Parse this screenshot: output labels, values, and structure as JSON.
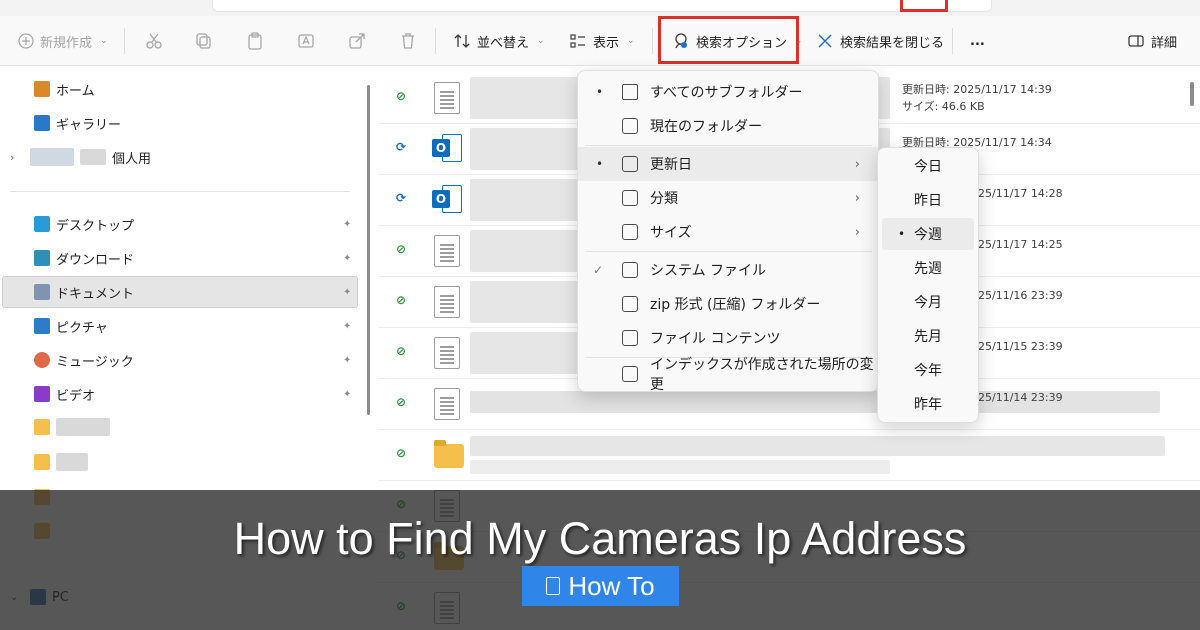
{
  "toolbar": {
    "new_label": "新規作成",
    "sort_label": "並べ替え",
    "view_label": "表示",
    "search_options_label": "検索オプション",
    "close_search_label": "検索結果を閉じる",
    "more_label": "...",
    "details_label": "詳細"
  },
  "nav": {
    "items": [
      {
        "label": "ホーム",
        "icon": "home-icon"
      },
      {
        "label": "ギャラリー",
        "icon": "gallery-icon"
      },
      {
        "label": "個人用",
        "icon": "onedrive-icon"
      },
      {
        "label": "デスクトップ",
        "icon": "desktop-icon"
      },
      {
        "label": "ダウンロード",
        "icon": "download-icon"
      },
      {
        "label": "ドキュメント",
        "icon": "documents-icon"
      },
      {
        "label": "ピクチャ",
        "icon": "pictures-icon"
      },
      {
        "label": "ミュージック",
        "icon": "music-icon"
      },
      {
        "label": "ビデオ",
        "icon": "video-icon"
      },
      {
        "label": "PC",
        "icon": "pc-icon"
      }
    ]
  },
  "files": {
    "rows": [
      {
        "meta1": "更新日時: 2025/11/17 14:39",
        "meta2": "サイズ: 46.6 KB",
        "status": "ok"
      },
      {
        "meta1": "更新日時: 2025/11/17 14:34",
        "meta2": "",
        "status": "sync"
      },
      {
        "meta1": "25/11/17 14:28",
        "meta2": "",
        "status": "sync"
      },
      {
        "meta1": "25/11/17 14:25",
        "meta2": "",
        "status": "ok"
      },
      {
        "meta1": "25/11/16 23:39",
        "meta2": "",
        "status": "ok"
      },
      {
        "meta1": "25/11/15 23:39",
        "meta2": "",
        "status": "ok"
      },
      {
        "meta1": "25/11/14 23:39",
        "meta2": "",
        "status": "ok"
      }
    ]
  },
  "menu": {
    "items": [
      {
        "label": "すべてのサブフォルダー",
        "bullet": "•"
      },
      {
        "label": "現在のフォルダー",
        "bullet": ""
      },
      {
        "label": "更新日",
        "bullet": "•",
        "arrow": "›"
      },
      {
        "label": "分類",
        "bullet": "",
        "arrow": "›"
      },
      {
        "label": "サイズ",
        "bullet": "",
        "arrow": "›"
      },
      {
        "label": "システム ファイル",
        "bullet": "✓"
      },
      {
        "label": "zip 形式 (圧縮) フォルダー",
        "bullet": ""
      },
      {
        "label": "ファイル コンテンツ",
        "bullet": ""
      },
      {
        "label": "インデックスが作成された場所の変更",
        "bullet": ""
      }
    ]
  },
  "submenu": {
    "items": [
      "今日",
      "昨日",
      "今週",
      "先週",
      "今月",
      "先月",
      "今年",
      "昨年"
    ],
    "selected": "今週"
  },
  "banner": {
    "title": "How to Find My Cameras Ip Address",
    "badge_label": "How To"
  },
  "colors": {
    "highlight": "#d9302c",
    "badge": "#2f86e8"
  }
}
